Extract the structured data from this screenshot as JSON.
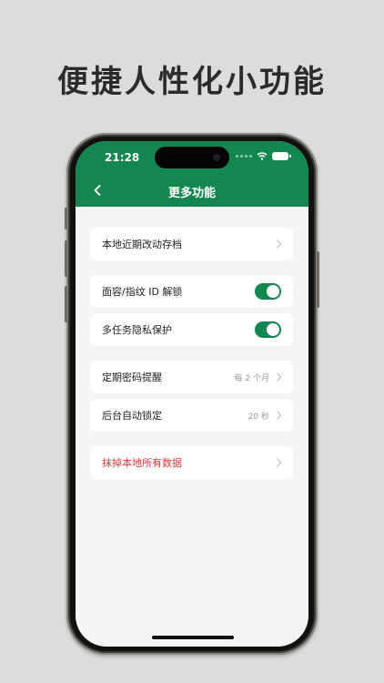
{
  "promo": {
    "title": "便捷人性化小功能"
  },
  "status_bar": {
    "time": "21:28"
  },
  "nav": {
    "title": "更多功能"
  },
  "items": [
    {
      "label": "本地近期改动存档",
      "type": "link"
    },
    {
      "label": "面容/指纹 ID 解锁",
      "type": "toggle",
      "on": true
    },
    {
      "label": "多任务隐私保护",
      "type": "toggle",
      "on": true
    },
    {
      "label": "定期密码提醒",
      "value": "每 2 个月",
      "type": "link"
    },
    {
      "label": "后台自动锁定",
      "value": "20 秒",
      "type": "link"
    },
    {
      "label": "抹掉本地所有数据",
      "type": "link",
      "danger": true
    }
  ],
  "colors": {
    "brand_green": "#13874f",
    "danger_red": "#e0373c"
  },
  "icons": [
    "chevron-left-icon",
    "chevron-right-icon",
    "wifi-icon",
    "battery-icon",
    "signal-icon"
  ]
}
